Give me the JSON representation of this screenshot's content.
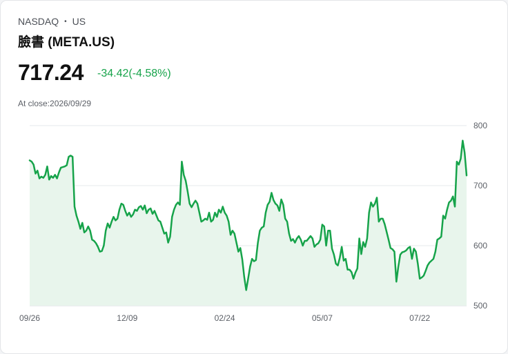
{
  "header": {
    "exchange": "NASDAQ",
    "separator": "•",
    "market": "US",
    "name": "臉書 (META.US)",
    "price": "717.24",
    "change": "-34.42(-4.58%)",
    "close_time": "At close:2026/09/29"
  },
  "colors": {
    "line": "#16a34a",
    "fill": "#e8f5ec",
    "change": "#16a34a"
  },
  "chart_data": {
    "type": "area",
    "title": "",
    "xlabel": "",
    "ylabel": "",
    "ylim": [
      500,
      800
    ],
    "yticks": [
      800,
      700,
      600,
      500
    ],
    "y_axis_side": "right",
    "grid": true,
    "legend": "none",
    "x_ticks": [
      {
        "label": "09/26",
        "index": 0
      },
      {
        "label": "12/09",
        "index": 50
      },
      {
        "label": "02/24",
        "index": 100
      },
      {
        "label": "05/07",
        "index": 150
      },
      {
        "label": "07/22",
        "index": 200
      }
    ],
    "series": [
      {
        "values": [
          742,
          740,
          735,
          720,
          725,
          712,
          715,
          713,
          718,
          732,
          710,
          716,
          713,
          718,
          712,
          722,
          730,
          731,
          732,
          734,
          748,
          750,
          748,
          665,
          650,
          640,
          628,
          638,
          622,
          625,
          632,
          625,
          610,
          608,
          604,
          598,
          590,
          591,
          600,
          625,
          637,
          630,
          640,
          648,
          642,
          645,
          660,
          670,
          668,
          658,
          650,
          655,
          648,
          652,
          660,
          658,
          664,
          666,
          660,
          667,
          654,
          660,
          662,
          653,
          658,
          650,
          642,
          640,
          630,
          620,
          622,
          605,
          615,
          648,
          660,
          668,
          672,
          668,
          740,
          718,
          708,
          690,
          670,
          664,
          670,
          675,
          670,
          655,
          640,
          642,
          645,
          643,
          655,
          640,
          643,
          655,
          648,
          660,
          655,
          665,
          655,
          650,
          640,
          618,
          625,
          620,
          605,
          590,
          596,
          577,
          548,
          526,
          545,
          565,
          578,
          574,
          576,
          605,
          625,
          630,
          632,
          655,
          668,
          673,
          688,
          676,
          670,
          667,
          658,
          677,
          668,
          645,
          640,
          620,
          608,
          611,
          605,
          612,
          616,
          610,
          600,
          608,
          608,
          612,
          616,
          612,
          598,
          602,
          604,
          610,
          635,
          632,
          600,
          625,
          625,
          595,
          585,
          570,
          567,
          580,
          598,
          575,
          578,
          560,
          560,
          556,
          545,
          555,
          562,
          612,
          586,
          606,
          598,
          612,
          655,
          672,
          665,
          670,
          680,
          640,
          645,
          645,
          636,
          623,
          610,
          596,
          594,
          590,
          540,
          565,
          585,
          589,
          590,
          592,
          596,
          598,
          578,
          595,
          590,
          570,
          545,
          547,
          550,
          558,
          567,
          572,
          575,
          578,
          590,
          610,
          612,
          615,
          650,
          645,
          660,
          672,
          675,
          682,
          665,
          740,
          735,
          745,
          775,
          755,
          717
        ]
      }
    ]
  }
}
